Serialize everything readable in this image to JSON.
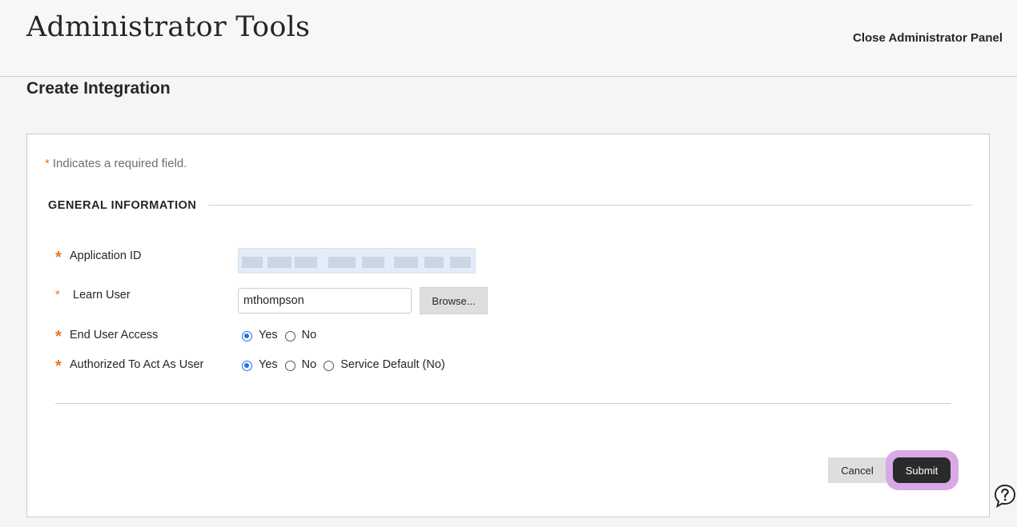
{
  "header": {
    "title": "Administrator Tools",
    "close_label": "Close Administrator Panel"
  },
  "page": {
    "heading": "Create Integration"
  },
  "form": {
    "required_note": "Indicates a required field.",
    "required_marker": "*",
    "section_title": "GENERAL INFORMATION",
    "fields": {
      "application_id": {
        "label": "Application ID",
        "value_redacted": true
      },
      "learn_user": {
        "label": "Learn User",
        "value": "mthompson",
        "browse_label": "Browse..."
      },
      "end_user_access": {
        "label": "End User Access",
        "options": [
          "Yes",
          "No"
        ],
        "selected": "Yes"
      },
      "authorized_to_act": {
        "label": "Authorized To Act As User",
        "options": [
          "Yes",
          "No",
          "Service Default (No)"
        ],
        "selected": "Yes"
      }
    },
    "cancel_label": "Cancel",
    "submit_label": "Submit"
  },
  "icons": {
    "help": "help-question-icon"
  },
  "colors": {
    "required": "#e87722",
    "radio_selected": "#1a73e8",
    "submit_bg": "#2a2a2a",
    "submit_highlight": "#d9a9e6"
  }
}
